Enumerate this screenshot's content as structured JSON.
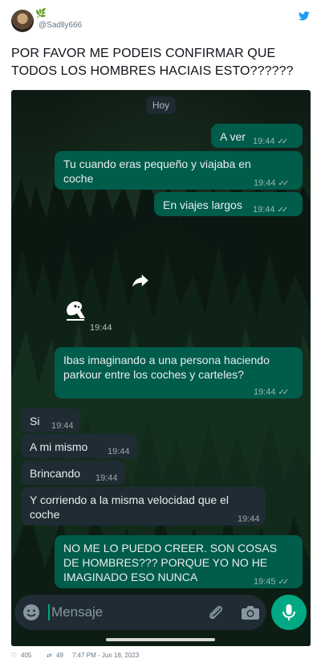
{
  "tweet": {
    "handle": "@Sadlly666",
    "emoji": "🌿",
    "text_lines": [
      "POR FAVOR ME PODEIS CONFIRMAR QUE",
      "TODOS LOS HOMBRES HACIAIS ESTO??????"
    ],
    "likes": "405",
    "retweets": "49",
    "datetime": "7:47 PM - Jun 18, 2023",
    "brand_color": "#1d9bf0"
  },
  "chat": {
    "date_chip": "Hoy",
    "messages": [
      {
        "dir": "out",
        "text": "A ver",
        "time": "19:44"
      },
      {
        "dir": "out",
        "text": "Tu cuando eras pequeño y viajaba en\ncoche",
        "time": "19:44"
      },
      {
        "dir": "out",
        "text": "En viajes largos",
        "time": "19:44"
      },
      {
        "dir": "in",
        "text": "",
        "time": "19:44",
        "kind": "sticker"
      },
      {
        "dir": "out",
        "text": "Ibas imaginando a una persona haciendo\nparkour entre los coches y carteles?",
        "time": "19:44"
      },
      {
        "dir": "in",
        "text": "Si",
        "time": "19:44"
      },
      {
        "dir": "in",
        "text": "A mi mismo",
        "time": "19:44"
      },
      {
        "dir": "in",
        "text": "Brincando",
        "time": "19:44"
      },
      {
        "dir": "in",
        "text": "Y corriendo a la misma velocidad que el\ncoche",
        "time": "19:44"
      },
      {
        "dir": "out",
        "text": "NO ME LO PUEDO CREER. SON COSAS\nDE HOMBRES??? PORQUE YO NO HE\nIMAGINADO ESO NUNCA",
        "time": "19:45"
      }
    ],
    "input_placeholder": "Mensaje",
    "colors": {
      "outgoing": "#005c4b",
      "incoming": "#1f2c33",
      "accent": "#00a884"
    }
  }
}
